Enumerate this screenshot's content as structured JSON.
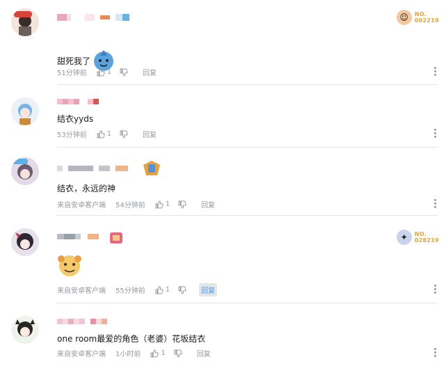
{
  "comments": [
    {
      "content": "甜死我了",
      "time": "51分钟前",
      "likes": "1",
      "reply": "回复",
      "source": "",
      "fan_badge": "NO.\n002219"
    },
    {
      "content": "结衣yyds",
      "time": "53分钟前",
      "likes": "1",
      "reply": "回复",
      "source": ""
    },
    {
      "content": "结衣，永远的神",
      "time": "54分钟前",
      "likes": "1",
      "reply": "回复",
      "source": "来自安卓客户端"
    },
    {
      "content": "",
      "time": "55分钟前",
      "likes": "1",
      "reply": "回复",
      "source": "来自安卓客户端",
      "fan_badge": "NO.\n028219"
    },
    {
      "content": "one room最爱的角色（老婆）花坂结衣",
      "time": "1小时前",
      "likes": "1",
      "reply": "回复",
      "source": "来自安卓客户端"
    }
  ],
  "colors": {
    "meta_gray": "#9499a0",
    "reply_active": "#4a96e8",
    "badge_gold": "#e3a332",
    "divider": "#e3e5e7"
  },
  "icons": [
    "thumb-up-icon",
    "thumb-down-icon",
    "more-icon",
    "fan-badge-icon",
    "medal-icon",
    "sticker-emote"
  ]
}
